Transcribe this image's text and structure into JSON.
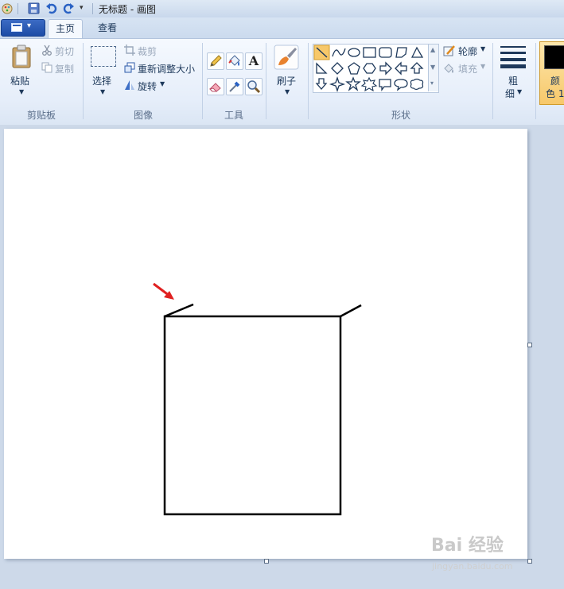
{
  "window": {
    "title": "无标题 - 画图"
  },
  "tabs": [
    {
      "label": "主页",
      "active": true
    },
    {
      "label": "查看",
      "active": false
    }
  ],
  "clipboard": {
    "paste_label": "粘贴",
    "cut_label": "剪切",
    "copy_label": "复制",
    "group_label": "剪贴板"
  },
  "image": {
    "select_label": "选择",
    "crop_label": "裁剪",
    "resize_label": "重新调整大小",
    "rotate_label": "旋转",
    "group_label": "图像"
  },
  "tools": {
    "group_label": "工具",
    "text_tool": "A"
  },
  "brushes": {
    "label": "刷子"
  },
  "shapes": {
    "outline_label": "轮廓",
    "fill_label": "填充",
    "group_label": "形状",
    "selected": "line"
  },
  "size": {
    "label_top": "粗",
    "label_bottom": "细"
  },
  "colors": {
    "color1_label_top": "颜",
    "color1_label_bottom": "色 1",
    "color1": "#000000",
    "accent": "#f7c86a"
  },
  "watermark": {
    "text": "Bai 经验",
    "url_text": "jingyan.baidu.com"
  }
}
